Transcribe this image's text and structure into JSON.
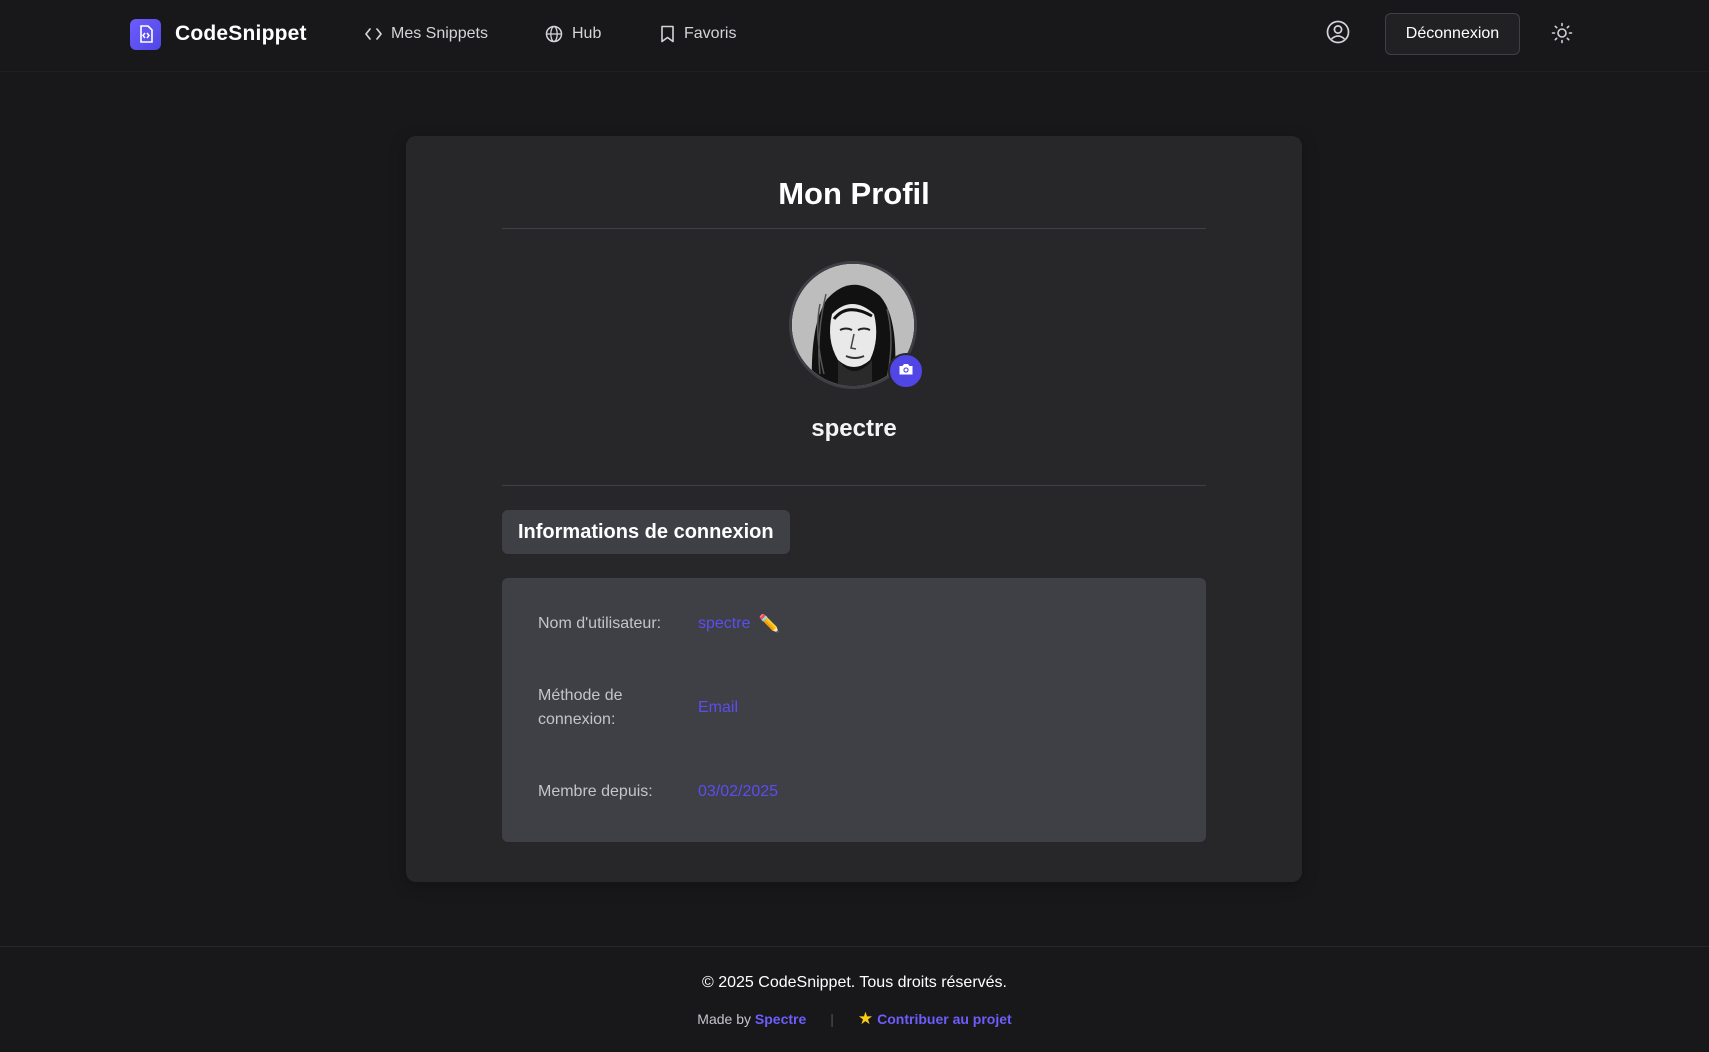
{
  "app": {
    "brand_name": "CodeSnippet"
  },
  "nav": {
    "items": [
      {
        "label": "Mes Snippets",
        "icon": "code-brackets-icon"
      },
      {
        "label": "Hub",
        "icon": "globe-icon"
      },
      {
        "label": "Favoris",
        "icon": "bookmark-icon"
      }
    ],
    "logout_label": "Déconnexion",
    "profile_icon": "user-circle-icon",
    "theme_icon": "sun-icon"
  },
  "profile": {
    "title": "Mon Profil",
    "username": "spectre",
    "section_title": "Informations de connexion",
    "fields": [
      {
        "label": "Nom d'utilisateur:",
        "value": "spectre"
      },
      {
        "label": "Méthode de connexion:",
        "value": "Email"
      },
      {
        "label": "Membre depuis:",
        "value": "03/02/2025"
      }
    ]
  },
  "footer": {
    "copyright": "© 2025 CodeSnippet. Tous droits réservés.",
    "made_by_prefix": "Made by",
    "author": "Spectre",
    "separator": "|",
    "contribute_label": "Contribuer au projet"
  },
  "colors": {
    "background": "#18181b",
    "card": "#27272a",
    "info_box": "#3f3f46",
    "accent": "#4f46e5",
    "value_text": "#5b4ef0"
  }
}
